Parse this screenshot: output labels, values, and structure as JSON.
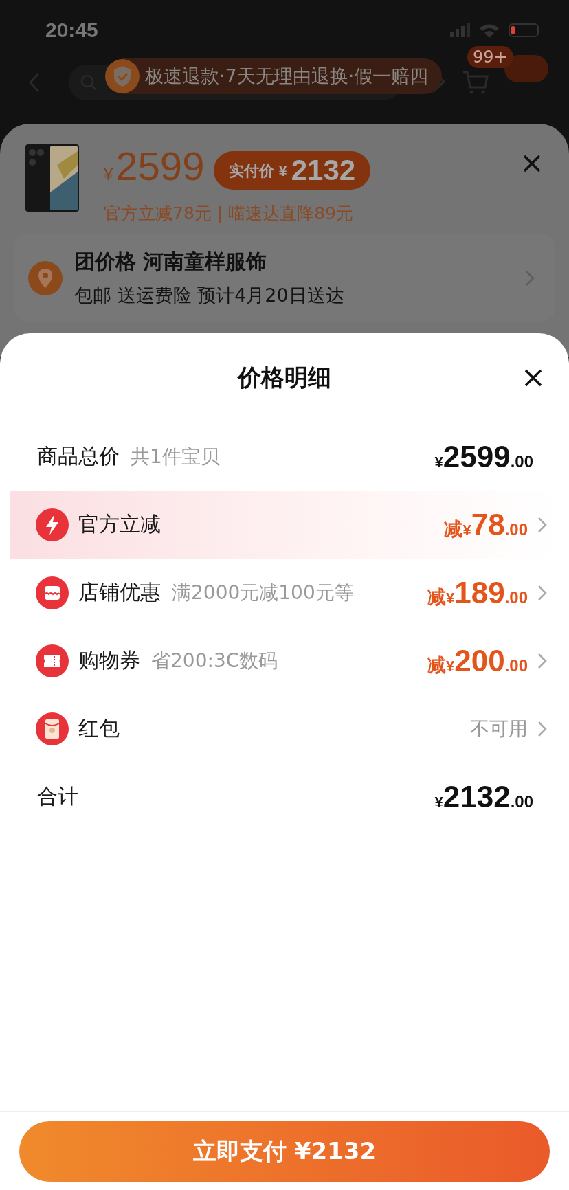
{
  "status_bar": {
    "time": "20:45"
  },
  "banner": {
    "text": "极速退款·7天无理由退换·假一赔四"
  },
  "nav": {
    "cart_badge": "99+"
  },
  "product": {
    "currency": "¥",
    "price": "2599",
    "pay_label": "实付价 ¥",
    "pay_price": "2132",
    "promo": "官方立减78元 | 喵速达直降89元"
  },
  "address": {
    "title": "团价格 河南童样服饰",
    "subtitle": "包邮 送运费险 预计4月20日送达"
  },
  "sheet": {
    "title": "价格明细",
    "rows": [
      {
        "kind": "total",
        "label": "商品总价",
        "note": "共1件宝贝",
        "currency": "¥",
        "integer": "2599",
        "decimal": ".00",
        "highlighted": false
      },
      {
        "kind": "discount",
        "label": "官方立减",
        "prefix": "减",
        "currency": "¥",
        "integer": "78",
        "decimal": ".00",
        "highlighted": true
      },
      {
        "kind": "discount",
        "label": "店铺优惠",
        "note": "满2000元减100元等",
        "prefix": "减",
        "currency": "¥",
        "integer": "189",
        "decimal": ".00",
        "highlighted": false
      },
      {
        "kind": "discount",
        "label": "购物券",
        "note": "省200:3C数码",
        "prefix": "减",
        "currency": "¥",
        "integer": "200",
        "decimal": ".00",
        "highlighted": false
      },
      {
        "kind": "status",
        "label": "红包",
        "status": "不可用",
        "highlighted": false
      },
      {
        "kind": "total",
        "label": "合计",
        "currency": "¥",
        "integer": "2132",
        "decimal": ".00",
        "highlighted": false
      }
    ]
  },
  "pay_button": {
    "label": "立即支付 ¥2132"
  }
}
